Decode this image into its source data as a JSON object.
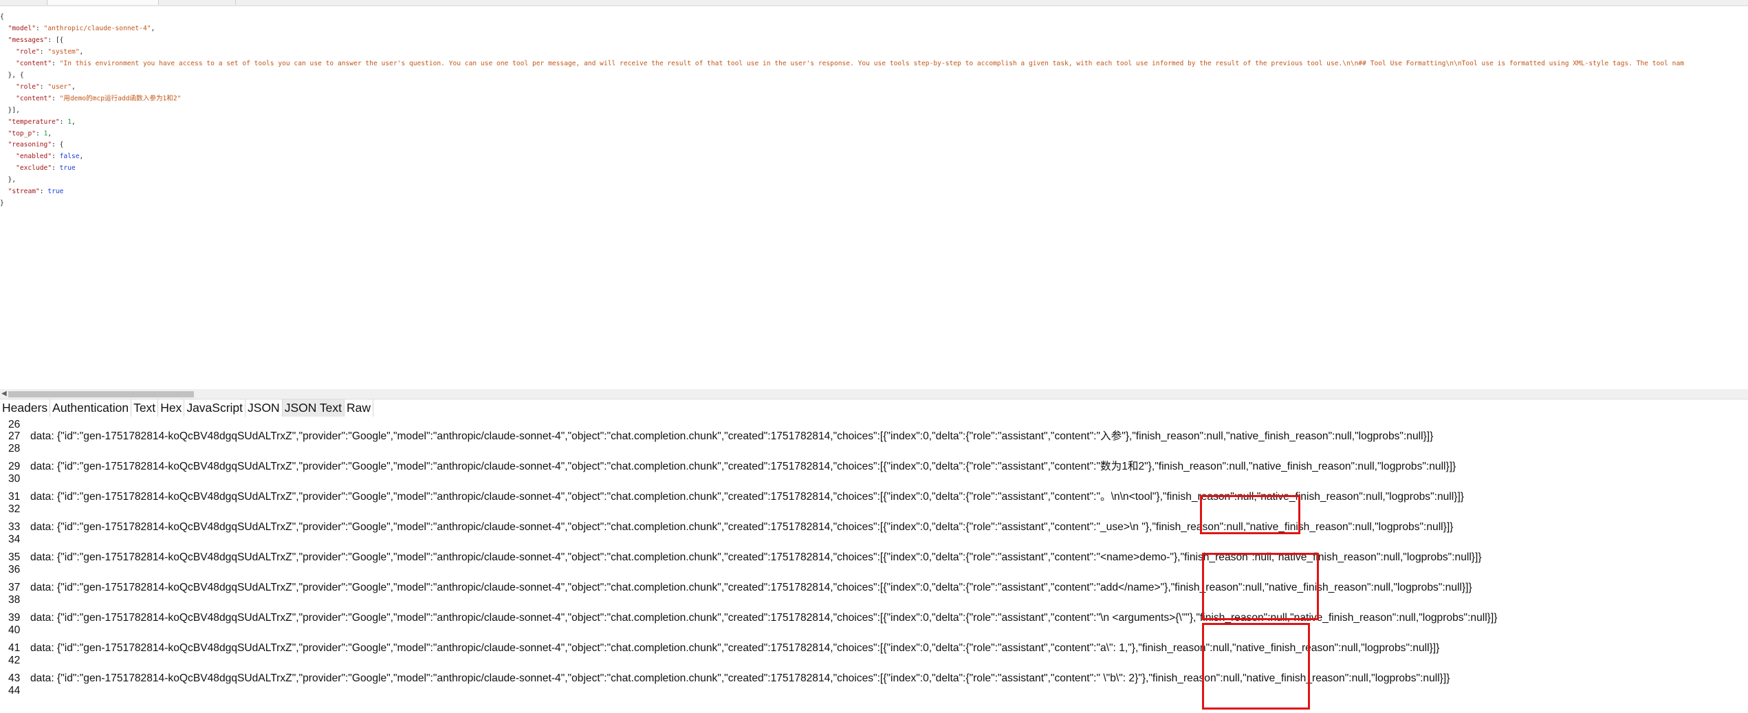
{
  "request_json": {
    "model_key": "\"model\"",
    "model_value": "\"anthropic/claude-sonnet-4\"",
    "messages_key": "\"messages\"",
    "role_key": "\"role\"",
    "system_value": "\"system\"",
    "content_key": "\"content\"",
    "system_content": "\"In this environment you have access to a set of tools you can use to answer the user's question. You can use one tool per message, and will receive the result of that tool use in the user's response. You use tools step-by-step to accomplish a given task, with each tool use informed by the result of the previous tool use.\\n\\n## Tool Use Formatting\\n\\nTool use is formatted using XML-style tags. The tool nam",
    "user_value": "\"user\"",
    "user_content": "\"用demo的mcp运行add函数入参为1和2\"",
    "temperature_key": "\"temperature\"",
    "temperature_value": "1",
    "top_p_key": "\"top_p\"",
    "top_p_value": "1",
    "reasoning_key": "\"reasoning\"",
    "enabled_key": "\"enabled\"",
    "enabled_value": "false",
    "exclude_key": "\"exclude\"",
    "exclude_value": "true",
    "stream_key": "\"stream\"",
    "stream_value": "true"
  },
  "tabs": [
    {
      "label": "Headers"
    },
    {
      "label": "Authentication"
    },
    {
      "label": "Text"
    },
    {
      "label": "Hex"
    },
    {
      "label": "JavaScript"
    },
    {
      "label": "JSON"
    },
    {
      "label": "JSON Text",
      "active": true
    },
    {
      "label": "Raw"
    }
  ],
  "response_lines": [
    {
      "num": "26",
      "text": ""
    },
    {
      "num": "27",
      "text": "data: {\"id\":\"gen-1751782814-koQcBV48dgqSUdALTrxZ\",\"provider\":\"Google\",\"model\":\"anthropic/claude-sonnet-4\",\"object\":\"chat.completion.chunk\",\"created\":1751782814,\"choices\":[{\"index\":0,\"delta\":{\"role\":\"assistant\",\"content\":\"入参\"},\"finish_reason\":null,\"native_finish_reason\":null,\"logprobs\":null}]}"
    },
    {
      "num": "28",
      "text": ""
    },
    {
      "num": "29",
      "text": "data: {\"id\":\"gen-1751782814-koQcBV48dgqSUdALTrxZ\",\"provider\":\"Google\",\"model\":\"anthropic/claude-sonnet-4\",\"object\":\"chat.completion.chunk\",\"created\":1751782814,\"choices\":[{\"index\":0,\"delta\":{\"role\":\"assistant\",\"content\":\"数为1和2\"},\"finish_reason\":null,\"native_finish_reason\":null,\"logprobs\":null}]}"
    },
    {
      "num": "30",
      "text": ""
    },
    {
      "num": "31",
      "text": "data: {\"id\":\"gen-1751782814-koQcBV48dgqSUdALTrxZ\",\"provider\":\"Google\",\"model\":\"anthropic/claude-sonnet-4\",\"object\":\"chat.completion.chunk\",\"created\":1751782814,\"choices\":[{\"index\":0,\"delta\":{\"role\":\"assistant\",\"content\":\"。\\n\\n<tool\"},\"finish_reason\":null,\"native_finish_reason\":null,\"logprobs\":null}]}"
    },
    {
      "num": "32",
      "text": ""
    },
    {
      "num": "33",
      "text": "data: {\"id\":\"gen-1751782814-koQcBV48dgqSUdALTrxZ\",\"provider\":\"Google\",\"model\":\"anthropic/claude-sonnet-4\",\"object\":\"chat.completion.chunk\",\"created\":1751782814,\"choices\":[{\"index\":0,\"delta\":{\"role\":\"assistant\",\"content\":\"_use>\\n  \"},\"finish_reason\":null,\"native_finish_reason\":null,\"logprobs\":null}]}"
    },
    {
      "num": "34",
      "text": ""
    },
    {
      "num": "35",
      "text": "data: {\"id\":\"gen-1751782814-koQcBV48dgqSUdALTrxZ\",\"provider\":\"Google\",\"model\":\"anthropic/claude-sonnet-4\",\"object\":\"chat.completion.chunk\",\"created\":1751782814,\"choices\":[{\"index\":0,\"delta\":{\"role\":\"assistant\",\"content\":\"<name>demo-\"},\"finish_reason\":null,\"native_finish_reason\":null,\"logprobs\":null}]}"
    },
    {
      "num": "36",
      "text": ""
    },
    {
      "num": "37",
      "text": "data: {\"id\":\"gen-1751782814-koQcBV48dgqSUdALTrxZ\",\"provider\":\"Google\",\"model\":\"anthropic/claude-sonnet-4\",\"object\":\"chat.completion.chunk\",\"created\":1751782814,\"choices\":[{\"index\":0,\"delta\":{\"role\":\"assistant\",\"content\":\"add</name>\"},\"finish_reason\":null,\"native_finish_reason\":null,\"logprobs\":null}]}"
    },
    {
      "num": "38",
      "text": ""
    },
    {
      "num": "39",
      "text": "data: {\"id\":\"gen-1751782814-koQcBV48dgqSUdALTrxZ\",\"provider\":\"Google\",\"model\":\"anthropic/claude-sonnet-4\",\"object\":\"chat.completion.chunk\",\"created\":1751782814,\"choices\":[{\"index\":0,\"delta\":{\"role\":\"assistant\",\"content\":\"\\n  <arguments>{\\\"\"},\"finish_reason\":null,\"native_finish_reason\":null,\"logprobs\":null}]}"
    },
    {
      "num": "40",
      "text": ""
    },
    {
      "num": "41",
      "text": "data: {\"id\":\"gen-1751782814-koQcBV48dgqSUdALTrxZ\",\"provider\":\"Google\",\"model\":\"anthropic/claude-sonnet-4\",\"object\":\"chat.completion.chunk\",\"created\":1751782814,\"choices\":[{\"index\":0,\"delta\":{\"role\":\"assistant\",\"content\":\"a\\\": 1,\"},\"finish_reason\":null,\"native_finish_reason\":null,\"logprobs\":null}]}"
    },
    {
      "num": "42",
      "text": ""
    },
    {
      "num": "43",
      "text": "data: {\"id\":\"gen-1751782814-koQcBV48dgqSUdALTrxZ\",\"provider\":\"Google\",\"model\":\"anthropic/claude-sonnet-4\",\"object\":\"chat.completion.chunk\",\"created\":1751782814,\"choices\":[{\"index\":0,\"delta\":{\"role\":\"assistant\",\"content\":\" \\\"b\\\": 2}\"},\"finish_reason\":null,\"native_finish_reason\":null,\"logprobs\":null}]}"
    },
    {
      "num": "44",
      "text": ""
    }
  ],
  "colors": {
    "highlight_border": "#e01414",
    "json_key": "#a31515",
    "json_string": "#c2571a",
    "json_number": "#1a9c3a",
    "json_bool": "#1a3fd6",
    "active_tab_bg": "#eaeaea"
  },
  "icons": {
    "scroll_left": "chevron-left-icon"
  }
}
